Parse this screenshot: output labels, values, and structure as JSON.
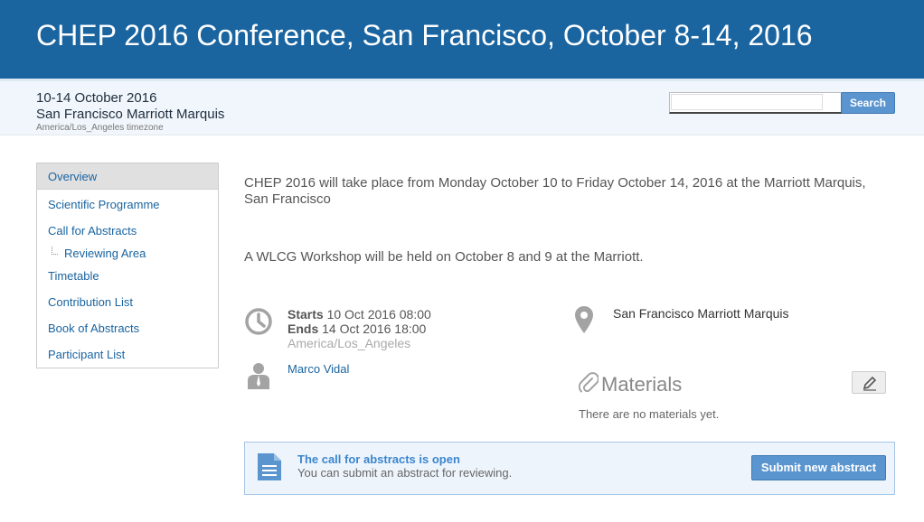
{
  "header": {
    "title": "CHEP 2016 Conference, San Francisco, October 8-14, 2016"
  },
  "event_info": {
    "dates": "10-14 October 2016",
    "venue": "San Francisco Marriott Marquis",
    "timezone": "America/Los_Angeles timezone"
  },
  "search": {
    "placeholder": "",
    "button_label": "Search"
  },
  "menu": {
    "items": [
      {
        "label": "Overview",
        "active": true
      },
      {
        "label": "Scientific Programme"
      },
      {
        "label": "Call for Abstracts"
      },
      {
        "label": "Reviewing Area",
        "sub": true
      },
      {
        "label": "Timetable"
      },
      {
        "label": "Contribution List"
      },
      {
        "label": "Book of Abstracts"
      },
      {
        "label": "Participant List"
      }
    ]
  },
  "main": {
    "description_1": "CHEP 2016 will take place from Monday October 10 to Friday October 14, 2016 at the Marriott Marquis, San Francisco",
    "description_2": "A WLCG Workshop will be held on October 8 and 9 at the Marriott.",
    "starts_label": "Starts",
    "starts_value": "10 Oct 2016 08:00",
    "ends_label": "Ends",
    "ends_value": "14 Oct 2016 18:00",
    "timezone": "America/Los_Angeles",
    "location": "San Francisco Marriott Marquis",
    "chair": "Marco Vidal",
    "materials_title": "Materials",
    "materials_empty": "There are no materials yet."
  },
  "cfa": {
    "title": "The call for abstracts is open",
    "subtitle": "You can submit an abstract for reviewing.",
    "button_label": "Submit new abstract"
  },
  "icons": {
    "clock": "clock-icon",
    "location": "map-pin-icon",
    "chair": "person-icon",
    "materials": "paperclip-icon",
    "edit": "pencil-icon",
    "document": "document-icon"
  },
  "colors": {
    "banner": "#1a64a0",
    "accent": "#5b95cf",
    "link": "#1a64a0"
  }
}
